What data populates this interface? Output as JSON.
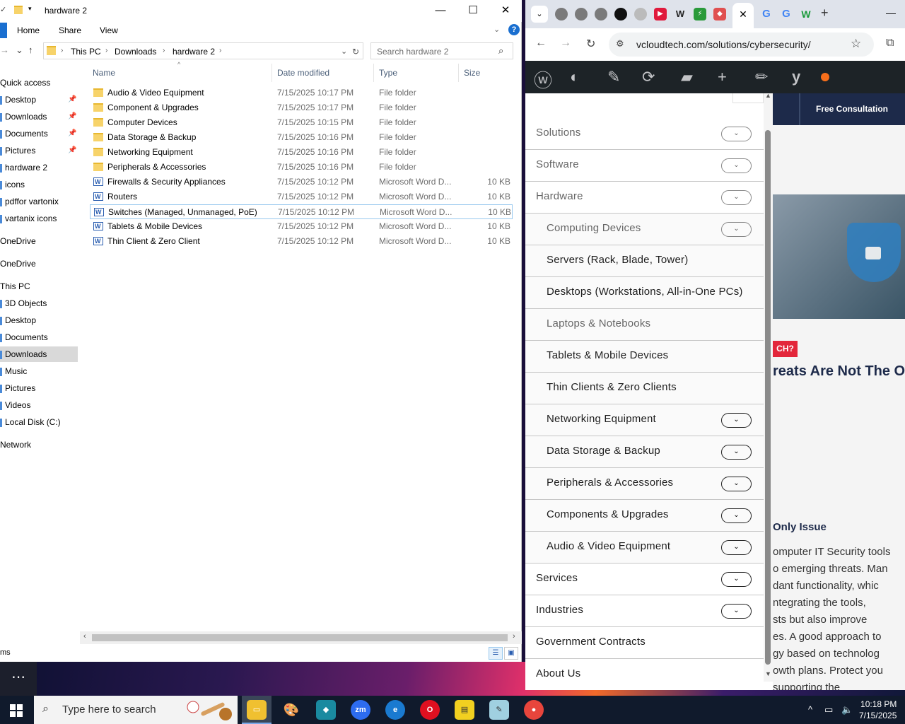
{
  "explorer": {
    "title": "hardware 2",
    "window_controls": {
      "minimize": "—",
      "maximize": "☐",
      "close": "✕"
    },
    "ribbon_tabs": [
      "Home",
      "Share",
      "View"
    ],
    "help": "?",
    "breadcrumb": [
      "This PC",
      "Downloads",
      "hardware 2"
    ],
    "search_placeholder": "Search hardware 2",
    "nav": {
      "quick_access": "Quick access",
      "pinned": [
        "Desktop",
        "Downloads",
        "Documents",
        "Pictures"
      ],
      "recent": [
        "hardware 2",
        "icons",
        "pdffor vartonix",
        "vartanix icons"
      ],
      "onedrive_1": "OneDrive",
      "onedrive_2": "OneDrive",
      "this_pc": "This PC",
      "pc_items": [
        "3D Objects",
        "Desktop",
        "Documents",
        "Downloads",
        "Music",
        "Pictures",
        "Videos",
        "Local Disk (C:)"
      ],
      "network": "Network",
      "selected": "Downloads"
    },
    "columns": {
      "name": "Name",
      "date": "Date modified",
      "type": "Type",
      "size": "Size"
    },
    "files": [
      {
        "name": "Audio & Video Equipment",
        "date": "7/15/2025 10:17 PM",
        "type": "File folder",
        "size": "",
        "kind": "folder"
      },
      {
        "name": "Component & Upgrades",
        "date": "7/15/2025 10:17 PM",
        "type": "File folder",
        "size": "",
        "kind": "folder"
      },
      {
        "name": "Computer Devices",
        "date": "7/15/2025 10:15 PM",
        "type": "File folder",
        "size": "",
        "kind": "folder"
      },
      {
        "name": "Data Storage & Backup",
        "date": "7/15/2025 10:16 PM",
        "type": "File folder",
        "size": "",
        "kind": "folder"
      },
      {
        "name": "Networking Equipment",
        "date": "7/15/2025 10:16 PM",
        "type": "File folder",
        "size": "",
        "kind": "folder"
      },
      {
        "name": "Peripherals & Accessories",
        "date": "7/15/2025 10:16 PM",
        "type": "File folder",
        "size": "",
        "kind": "folder"
      },
      {
        "name": "Firewalls & Security Appliances",
        "date": "7/15/2025 10:12 PM",
        "type": "Microsoft Word D...",
        "size": "10 KB",
        "kind": "word"
      },
      {
        "name": "Routers",
        "date": "7/15/2025 10:12 PM",
        "type": "Microsoft Word D...",
        "size": "10 KB",
        "kind": "word"
      },
      {
        "name": "Switches (Managed, Unmanaged, PoE)",
        "date": "7/15/2025 10:12 PM",
        "type": "Microsoft Word D...",
        "size": "10 KB",
        "kind": "word"
      },
      {
        "name": "Tablets & Mobile Devices",
        "date": "7/15/2025 10:12 PM",
        "type": "Microsoft Word D...",
        "size": "10 KB",
        "kind": "word"
      },
      {
        "name": "Thin Client & Zero Client",
        "date": "7/15/2025 10:12 PM",
        "type": "Microsoft Word D...",
        "size": "10 KB",
        "kind": "word"
      }
    ],
    "status_text": "ms"
  },
  "browser": {
    "url": "vcloudtech.com/solutions/cybersecurity/",
    "active_tab_close": "✕",
    "new_tab": "+",
    "free_consultation": "Free Consultation",
    "badge": "CH?",
    "heading_fragment": "reats Are Not The O",
    "subheading_fragment": "Only Issue",
    "body_lines": [
      "omputer IT Security tools",
      "o emerging threats. Man",
      "dant functionality, whic",
      "ntegrating the tools,",
      "sts but also improve",
      "es. A good approach to",
      "gy based on technolog",
      "owth plans. Protect you",
      "supporting the"
    ],
    "menu": [
      {
        "label": "Solutions",
        "level": 0,
        "toggle": true,
        "light": true
      },
      {
        "label": "Software",
        "level": 0,
        "toggle": true,
        "light": true
      },
      {
        "label": "Hardware",
        "level": 0,
        "toggle": true,
        "light": true
      },
      {
        "label": "Computing Devices",
        "level": 1,
        "toggle": true,
        "light": true
      },
      {
        "label": "Servers (Rack, Blade, Tower)",
        "level": 1,
        "toggle": false,
        "light": false
      },
      {
        "label": "Desktops (Workstations, All-in-One PCs)",
        "level": 1,
        "toggle": false,
        "light": false
      },
      {
        "label": "Laptops & Notebooks",
        "level": 1,
        "toggle": false,
        "light": true
      },
      {
        "label": "Tablets & Mobile Devices",
        "level": 1,
        "toggle": false,
        "light": false
      },
      {
        "label": "Thin Clients & Zero Clients",
        "level": 1,
        "toggle": false,
        "light": false
      },
      {
        "label": "Networking Equipment",
        "level": 1,
        "toggle": true,
        "light": false
      },
      {
        "label": "Data Storage & Backup",
        "level": 1,
        "toggle": true,
        "light": false
      },
      {
        "label": "Peripherals & Accessories",
        "level": 1,
        "toggle": true,
        "light": false
      },
      {
        "label": "Components & Upgrades",
        "level": 1,
        "toggle": true,
        "light": false
      },
      {
        "label": "Audio & Video Equipment",
        "level": 1,
        "toggle": true,
        "light": false
      },
      {
        "label": "Services",
        "level": 0,
        "toggle": true,
        "light": false
      },
      {
        "label": "Industries",
        "level": 0,
        "toggle": true,
        "light": false
      },
      {
        "label": "Government Contracts",
        "level": 0,
        "toggle": false,
        "light": false
      },
      {
        "label": "About Us",
        "level": 0,
        "toggle": false,
        "light": false
      }
    ]
  },
  "taskbar": {
    "search_placeholder": "Type here to search",
    "time": "10:18 PM",
    "date": "7/15/2025",
    "zoom_label": "zm"
  },
  "colors": {
    "wp_admin_bar": "#1d2327",
    "accent_blue": "#1a6fd0",
    "badge_red": "#e3263a",
    "navy": "#1d2a4a"
  }
}
